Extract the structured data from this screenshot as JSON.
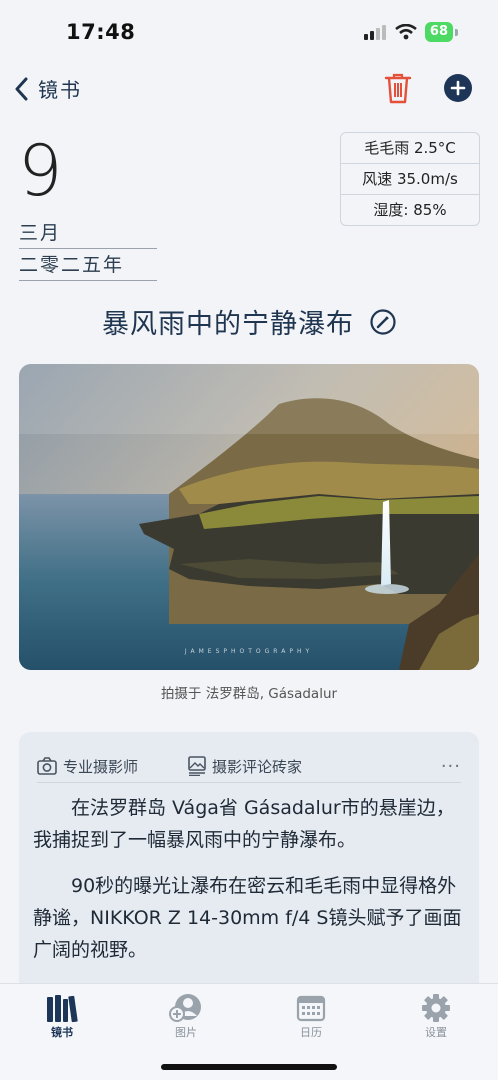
{
  "status": {
    "time": "17:48",
    "battery": "68"
  },
  "nav": {
    "back_label": "镜书"
  },
  "date": {
    "day": "9",
    "month": "三月",
    "year": "二零二五年"
  },
  "weather": {
    "condition": "毛毛雨 2.5°C",
    "wind": "风速 35.0m/s",
    "humidity": "湿度: 85%"
  },
  "entry": {
    "title": "暴风雨中的宁静瀑布",
    "caption": "拍摄于 法罗群岛, Gásadalur",
    "photo_watermark": "JAMESPHOTOGRAPHY"
  },
  "card": {
    "tag1": "专业摄影师",
    "tag2": "摄影评论砖家",
    "more": "···",
    "para1": "在法罗群岛 Vága省 Gásadalur市的悬崖边，我捕捉到了一幅暴风雨中的宁静瀑布。",
    "para2": "90秒的曝光让瀑布在密云和毛毛雨中显得格外静谧，NIKKOR Z 14-30mm f/4 S镜头赋予了画面广阔的视野。"
  },
  "tabs": [
    {
      "label": "镜书",
      "icon": "books-icon"
    },
    {
      "label": "图片",
      "icon": "add-photo-icon"
    },
    {
      "label": "日历",
      "icon": "calendar-icon"
    },
    {
      "label": "设置",
      "icon": "gear-icon"
    }
  ],
  "colors": {
    "accent": "#1d3557",
    "trash": "#e4513b",
    "battery": "#4cd964"
  }
}
